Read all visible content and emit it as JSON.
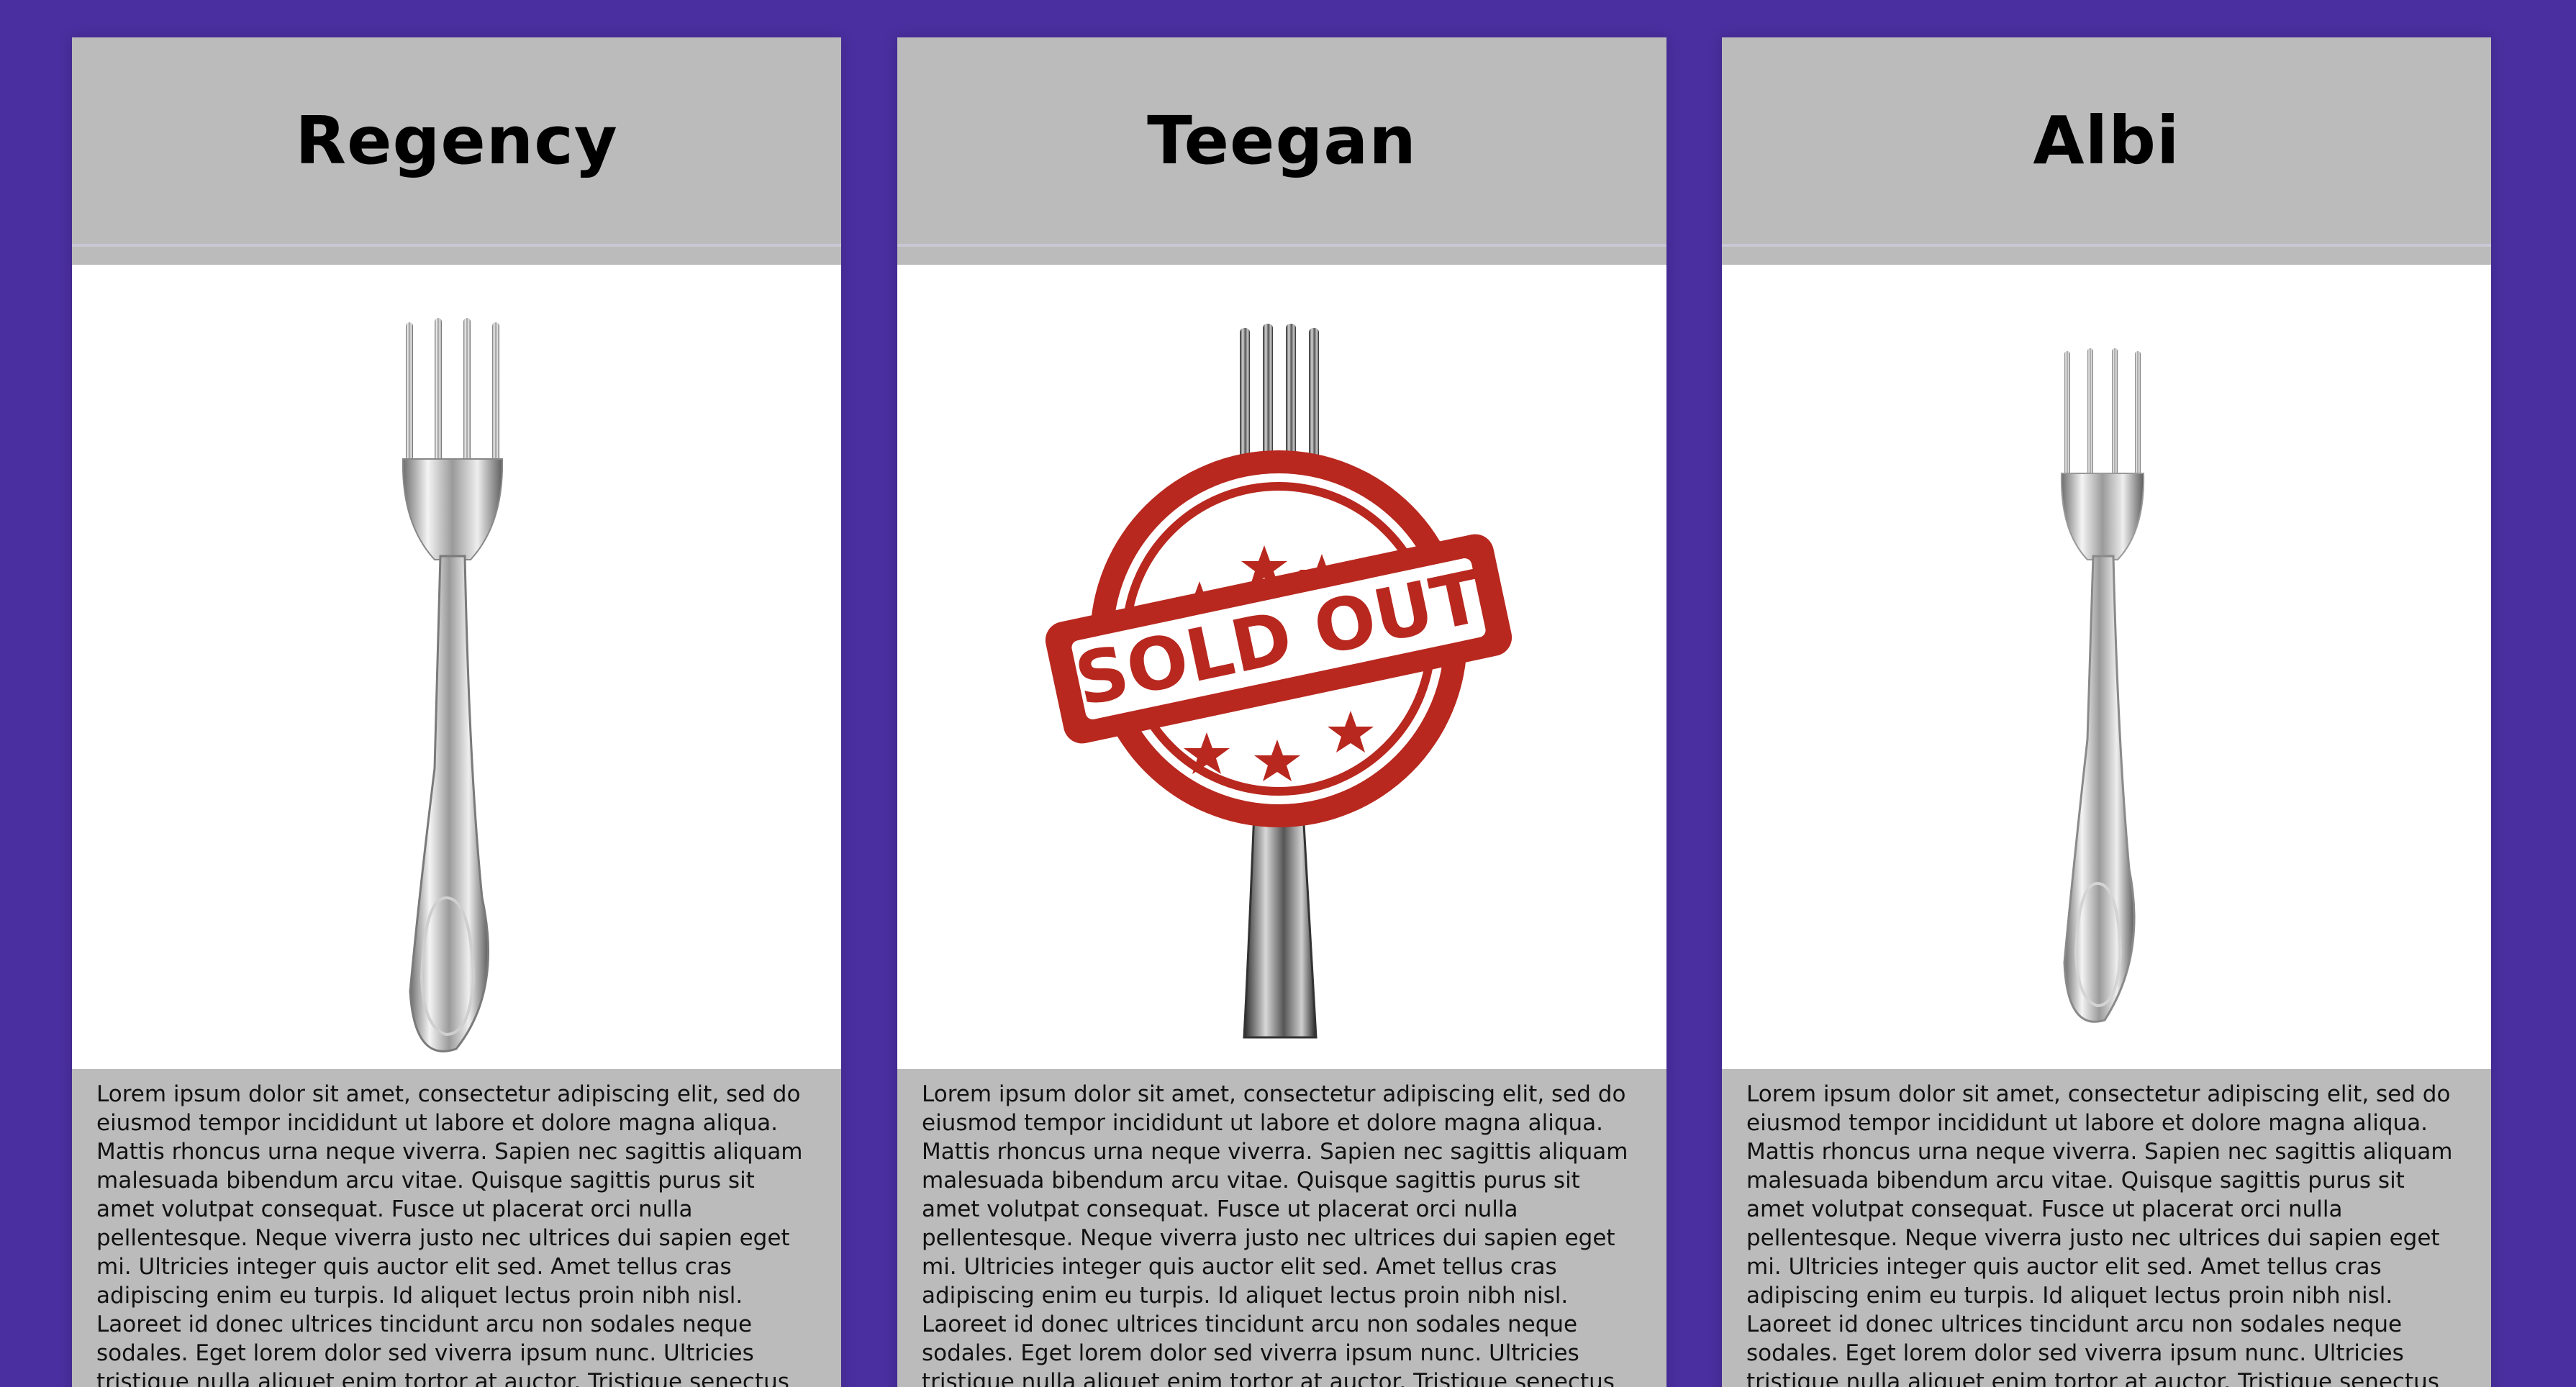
{
  "products": [
    {
      "name": "Regency",
      "image_icon": "fork-icon",
      "sold_out": false,
      "description": "Lorem ipsum dolor sit amet, consectetur adipiscing elit, sed do eiusmod tempor incididunt ut labore et dolore magna aliqua. Mattis rhoncus urna neque viverra. Sapien nec sagittis aliquam malesuada bibendum arcu vitae. Quisque sagittis purus sit amet volutpat consequat. Fusce ut placerat orci nulla pellentesque. Neque viverra justo nec ultrices dui sapien eget mi. Ultricies integer quis auctor elit sed. Amet tellus cras adipiscing enim eu turpis. Id aliquet lectus proin nibh nisl. Laoreet id donec ultrices tincidunt arcu non sodales neque sodales. Eget lorem dolor sed viverra ipsum nunc. Ultricies tristique nulla aliquet enim tortor at auctor. Tristique senectus et netus et malesuada fames ac"
    },
    {
      "name": "Teegan",
      "image_icon": "fork-icon",
      "sold_out": true,
      "stamp_text": "SOLD OUT",
      "description": "Lorem ipsum dolor sit amet, consectetur adipiscing elit, sed do eiusmod tempor incididunt ut labore et dolore magna aliqua. Mattis rhoncus urna neque viverra. Sapien nec sagittis aliquam malesuada bibendum arcu vitae. Quisque sagittis purus sit amet volutpat consequat. Fusce ut placerat orci nulla pellentesque. Neque viverra justo nec ultrices dui sapien eget mi. Ultricies integer quis auctor elit sed. Amet tellus cras adipiscing enim eu turpis. Id aliquet lectus proin nibh nisl. Laoreet id donec ultrices tincidunt arcu non sodales neque sodales. Eget lorem dolor sed viverra ipsum nunc. Ultricies tristique nulla aliquet enim tortor at auctor. Tristique senectus et netus et malesuada fames ac"
    },
    {
      "name": "Albi",
      "image_icon": "fork-icon",
      "sold_out": false,
      "description": "Lorem ipsum dolor sit amet, consectetur adipiscing elit, sed do eiusmod tempor incididunt ut labore et dolore magna aliqua. Mattis rhoncus urna neque viverra. Sapien nec sagittis aliquam malesuada bibendum arcu vitae. Quisque sagittis purus sit amet volutpat consequat. Fusce ut placerat orci nulla pellentesque. Neque viverra justo nec ultrices dui sapien eget mi. Ultricies integer quis auctor elit sed. Amet tellus cras adipiscing enim eu turpis. Id aliquet lectus proin nibh nisl. Laoreet id donec ultrices tincidunt arcu non sodales neque sodales. Eget lorem dolor sed viverra ipsum nunc. Ultricies tristique nulla aliquet enim tortor at auctor. Tristique senectus et netus et malesuada fames ac"
    }
  ],
  "colors": {
    "page_background": "#4a2fa0",
    "card_band": "#bbbbbb",
    "image_background": "#ffffff",
    "stamp_red": "#b8281f"
  }
}
